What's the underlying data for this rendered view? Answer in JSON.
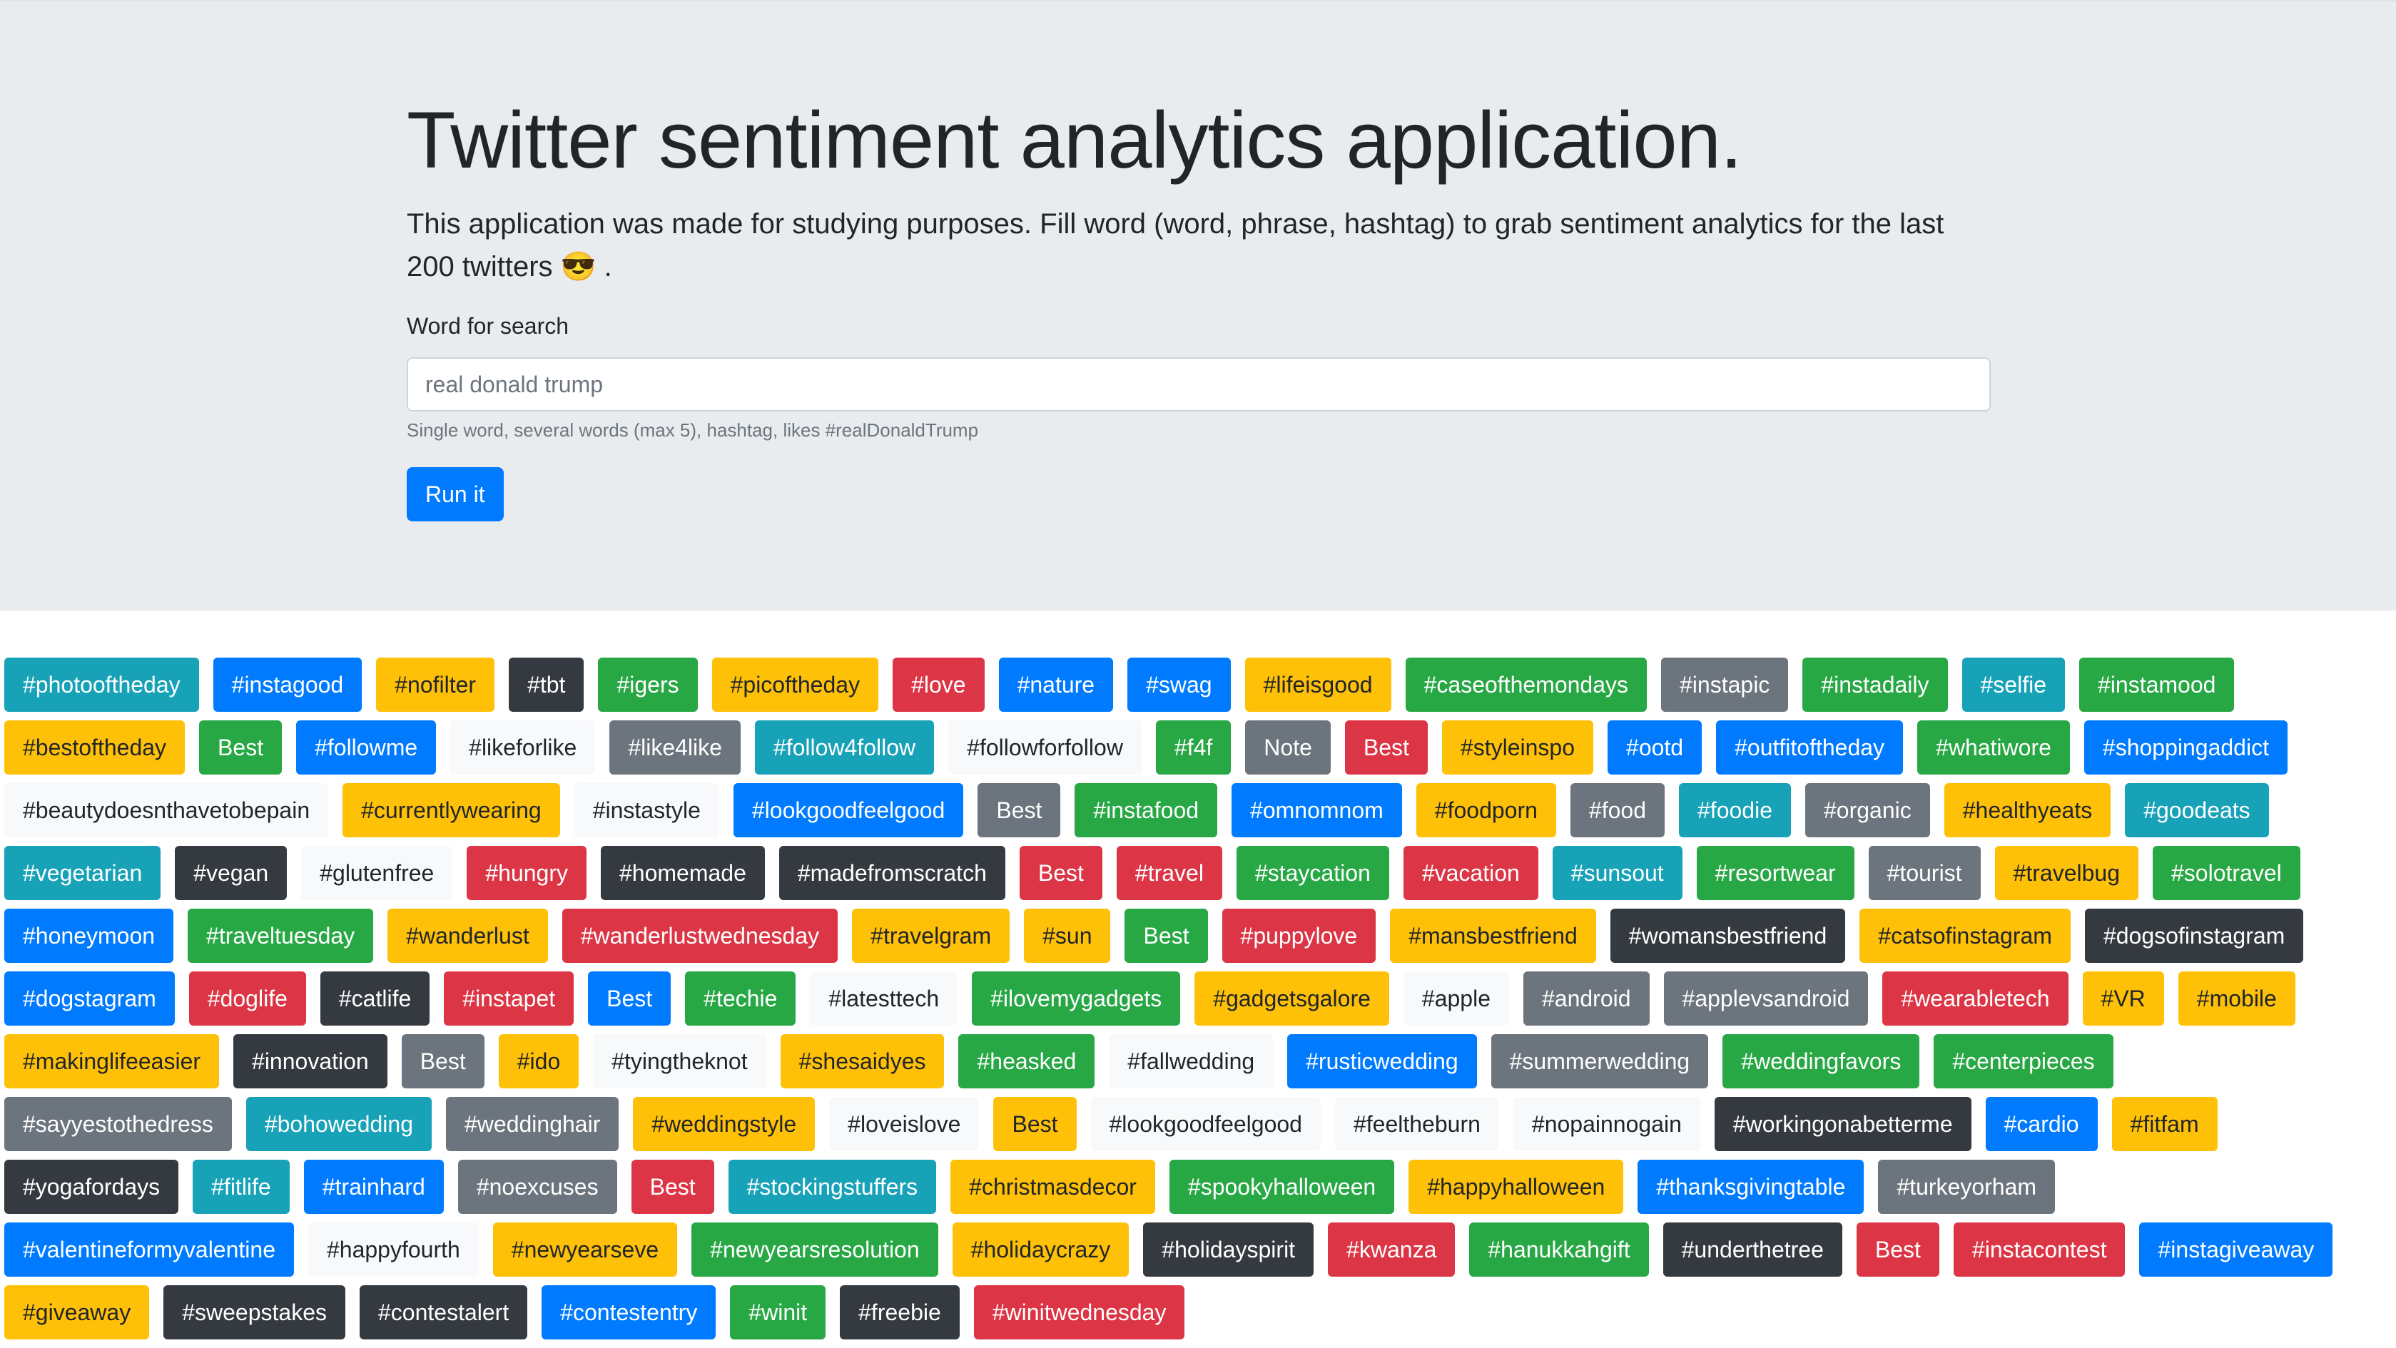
{
  "header": {
    "title": "Twitter sentiment analytics application.",
    "lead": "This application was made for studying purposes. Fill word (word, phrase, hashtag) to grab sentiment analytics for the last 200 twitters 😎 .",
    "field_label": "Word for search",
    "search_placeholder": "real donald trump",
    "help_text": "Single word, several words (max 5), hashtag, likes #realDonaldTrump",
    "run_button": "Run it"
  },
  "colors": {
    "info": "#17a2b8",
    "primary": "#007bff",
    "warning": "#ffc107",
    "dark": "#343a40",
    "success": "#28a745",
    "danger": "#dc3545",
    "secondary": "#6c757d",
    "light": "#f8f9fa"
  },
  "tag_rows": [
    [
      [
        "#photooftheday",
        "info"
      ],
      [
        "#instagood",
        "primary"
      ],
      [
        "#nofilter",
        "warning"
      ],
      [
        "#tbt",
        "dark"
      ],
      [
        "#igers",
        "success"
      ],
      [
        "#picoftheday",
        "warning"
      ],
      [
        "#love",
        "danger"
      ],
      [
        "#nature",
        "primary"
      ],
      [
        "#swag",
        "primary"
      ],
      [
        "#lifeisgood",
        "warning"
      ],
      [
        "#caseofthemondays",
        "success"
      ],
      [
        "#instapic",
        "secondary"
      ],
      [
        "#instadaily",
        "success"
      ],
      [
        "#selfie",
        "info"
      ],
      [
        "#instamood",
        "success"
      ]
    ],
    [
      [
        "#bestoftheday",
        "warning"
      ],
      [
        "Best",
        "success"
      ],
      [
        "#followme",
        "primary"
      ],
      [
        "#likeforlike",
        "light"
      ],
      [
        "#like4like",
        "secondary"
      ],
      [
        "#follow4follow",
        "info"
      ],
      [
        "#followforfollow",
        "light"
      ],
      [
        "#f4f",
        "success"
      ],
      [
        "Note",
        "secondary"
      ],
      [
        "Best",
        "danger"
      ],
      [
        "#styleinspo",
        "warning"
      ],
      [
        "#ootd",
        "primary"
      ],
      [
        "#outfitoftheday",
        "primary"
      ],
      [
        "#whatiwore",
        "success"
      ],
      [
        "#shoppingaddict",
        "primary"
      ]
    ],
    [
      [
        "#beautydoesnthavetobepain",
        "light"
      ],
      [
        "#currentlywearing",
        "warning"
      ],
      [
        "#instastyle",
        "light"
      ],
      [
        "#lookgoodfeelgood",
        "primary"
      ],
      [
        "Best",
        "secondary"
      ],
      [
        "#instafood",
        "success"
      ],
      [
        "#omnomnom",
        "primary"
      ],
      [
        "#foodporn",
        "warning"
      ],
      [
        "#food",
        "secondary"
      ],
      [
        "#foodie",
        "info"
      ],
      [
        "#organic",
        "secondary"
      ],
      [
        "#healthyeats",
        "warning"
      ],
      [
        "#goodeats",
        "info"
      ]
    ],
    [
      [
        "#vegetarian",
        "info"
      ],
      [
        "#vegan",
        "dark"
      ],
      [
        "#glutenfree",
        "light"
      ],
      [
        "#hungry",
        "danger"
      ],
      [
        "#homemade",
        "dark"
      ],
      [
        "#madefromscratch",
        "dark"
      ],
      [
        "Best",
        "danger"
      ],
      [
        "#travel",
        "danger"
      ],
      [
        "#staycation",
        "success"
      ],
      [
        "#vacation",
        "danger"
      ],
      [
        "#sunsout",
        "info"
      ],
      [
        "#resortwear",
        "success"
      ],
      [
        "#tourist",
        "secondary"
      ],
      [
        "#travelbug",
        "warning"
      ],
      [
        "#solotravel",
        "success"
      ]
    ],
    [
      [
        "#honeymoon",
        "primary"
      ],
      [
        "#traveltuesday",
        "success"
      ],
      [
        "#wanderlust",
        "warning"
      ],
      [
        "#wanderlustwednesday",
        "danger"
      ],
      [
        "#travelgram",
        "warning"
      ],
      [
        "#sun",
        "warning"
      ],
      [
        "Best",
        "success"
      ],
      [
        "#puppylove",
        "danger"
      ],
      [
        "#mansbestfriend",
        "warning"
      ],
      [
        "#womansbestfriend",
        "dark"
      ],
      [
        "#catsofinstagram",
        "warning"
      ],
      [
        "#dogsofinstagram",
        "dark"
      ]
    ],
    [
      [
        "#dogstagram",
        "primary"
      ],
      [
        "#doglife",
        "danger"
      ],
      [
        "#catlife",
        "dark"
      ],
      [
        "#instapet",
        "danger"
      ],
      [
        "Best",
        "primary"
      ],
      [
        "#techie",
        "success"
      ],
      [
        "#latesttech",
        "light"
      ],
      [
        "#ilovemygadgets",
        "success"
      ],
      [
        "#gadgetsgalore",
        "warning"
      ],
      [
        "#apple",
        "light"
      ],
      [
        "#android",
        "secondary"
      ],
      [
        "#applevsandroid",
        "secondary"
      ],
      [
        "#wearabletech",
        "danger"
      ],
      [
        "#VR",
        "warning"
      ],
      [
        "#mobile",
        "warning"
      ]
    ],
    [
      [
        "#makinglifeeasier",
        "warning"
      ],
      [
        "#innovation",
        "dark"
      ],
      [
        "Best",
        "secondary"
      ],
      [
        "#ido",
        "warning"
      ],
      [
        "#tyingtheknot",
        "light"
      ],
      [
        "#shesaidyes",
        "warning"
      ],
      [
        "#heasked",
        "success"
      ],
      [
        "#fallwedding",
        "light"
      ],
      [
        "#rusticwedding",
        "primary"
      ],
      [
        "#summerwedding",
        "secondary"
      ],
      [
        "#weddingfavors",
        "success"
      ],
      [
        "#centerpieces",
        "success"
      ]
    ],
    [
      [
        "#sayyestothedress",
        "secondary"
      ],
      [
        "#bohowedding",
        "info"
      ],
      [
        "#weddinghair",
        "secondary"
      ],
      [
        "#weddingstyle",
        "warning"
      ],
      [
        "#loveislove",
        "light"
      ],
      [
        "Best",
        "warning"
      ],
      [
        "#lookgoodfeelgood",
        "light"
      ],
      [
        "#feeltheburn",
        "light"
      ],
      [
        "#nopainnogain",
        "light"
      ],
      [
        "#workingonabetterme",
        "dark"
      ],
      [
        "#cardio",
        "primary"
      ],
      [
        "#fitfam",
        "warning"
      ]
    ],
    [
      [
        "#yogafordays",
        "dark"
      ],
      [
        "#fitlife",
        "info"
      ],
      [
        "#trainhard",
        "primary"
      ],
      [
        "#noexcuses",
        "secondary"
      ],
      [
        "Best",
        "danger"
      ],
      [
        "#stockingstuffers",
        "info"
      ],
      [
        "#christmasdecor",
        "warning"
      ],
      [
        "#spookyhalloween",
        "success"
      ],
      [
        "#happyhalloween",
        "warning"
      ],
      [
        "#thanksgivingtable",
        "primary"
      ],
      [
        "#turkeyorham",
        "secondary"
      ]
    ],
    [
      [
        "#valentineformyvalentine",
        "primary"
      ],
      [
        "#happyfourth",
        "light"
      ],
      [
        "#newyearseve",
        "warning"
      ],
      [
        "#newyearsresolution",
        "success"
      ],
      [
        "#holidaycrazy",
        "warning"
      ],
      [
        "#holidayspirit",
        "dark"
      ],
      [
        "#kwanza",
        "danger"
      ],
      [
        "#hanukkahgift",
        "success"
      ],
      [
        "#underthetree",
        "dark"
      ],
      [
        "Best",
        "danger"
      ],
      [
        "#instacontest",
        "danger"
      ],
      [
        "#instagiveaway",
        "primary"
      ]
    ],
    [
      [
        "#giveaway",
        "warning"
      ],
      [
        "#sweepstakes",
        "dark"
      ],
      [
        "#contestalert",
        "dark"
      ],
      [
        "#contestentry",
        "primary"
      ],
      [
        "#winit",
        "success"
      ],
      [
        "#freebie",
        "dark"
      ],
      [
        "#winitwednesday",
        "danger"
      ]
    ]
  ]
}
